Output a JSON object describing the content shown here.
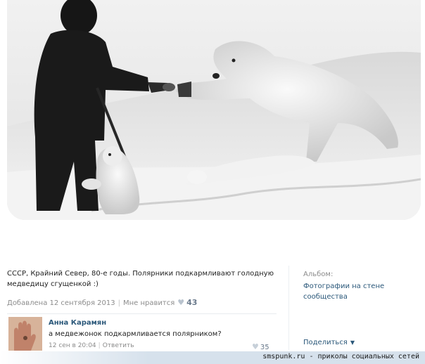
{
  "post": {
    "caption": "СССР, Крайний Север, 80-е годы. Полярники подкармливают голодную медведицу сгущенкой :)",
    "added": "Добавлена 12 сентября 2013",
    "like_label": "Мне нравится",
    "like_count": "43"
  },
  "comment": {
    "author": "Анна Карамян",
    "text": "а медвежонок подкармливается полярником?",
    "date": "12 сен в 20:04",
    "reply_label": "Ответить",
    "like_count": "35"
  },
  "sidebar": {
    "album_label": "Альбом:",
    "album_name": "Фотографии на стене сообщества",
    "share_label": "Поделиться"
  },
  "watermark": "smspunk.ru - приколы социальных сетей",
  "icons": {
    "like": "heart-icon",
    "share_dropdown": "chevron-down-icon"
  },
  "colors": {
    "link": "#2b587a",
    "muted": "#8c8c8c",
    "like_count": "#6a7a8c"
  }
}
